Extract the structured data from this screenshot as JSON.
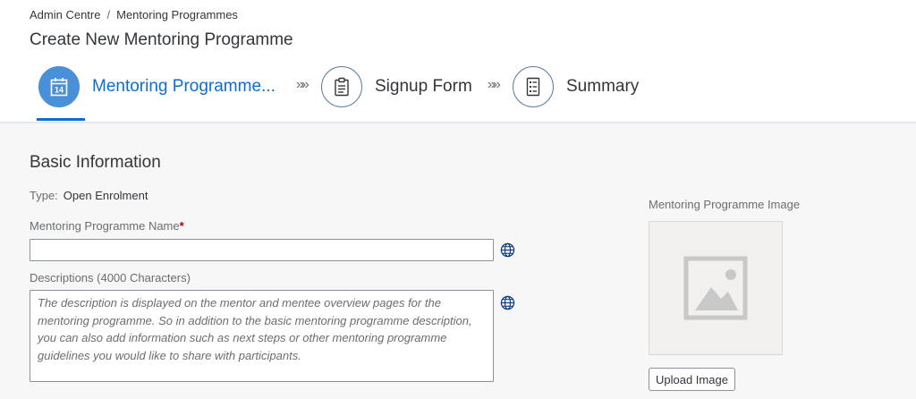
{
  "breadcrumb": {
    "items": [
      "Admin Centre",
      "Mentoring Programmes"
    ],
    "separator": "/"
  },
  "page_title": "Create New Mentoring Programme",
  "steps": [
    {
      "label": "Mentoring Programme...",
      "icon": "calendar-icon",
      "icon_text": "14",
      "active": true
    },
    {
      "label": "Signup Form",
      "icon": "clipboard-icon",
      "active": false
    },
    {
      "label": "Summary",
      "icon": "list-icon",
      "active": false
    }
  ],
  "step_separator": "»»",
  "basic_info": {
    "title": "Basic Information",
    "type_label": "Type:",
    "type_value": "Open Enrolment",
    "name_label": "Mentoring Programme Name",
    "required_marker": "*",
    "name_value": "",
    "description_label": "Descriptions (4000 Characters)",
    "description_placeholder": "The description is displayed on the mentor and mentee overview pages for the mentoring programme. So in addition to the basic mentoring programme description, you can also add information such as next steps or other mentoring programme guidelines you would like to share with participants."
  },
  "image": {
    "label": "Mentoring Programme Image",
    "placeholder_icon": "image-placeholder-icon",
    "upload_label": "Upload Image"
  },
  "colors": {
    "accent": "#0a6ed1",
    "active_step_fill": "#4a90d9",
    "required": "#bb0000",
    "background": "#f7f7f7"
  }
}
